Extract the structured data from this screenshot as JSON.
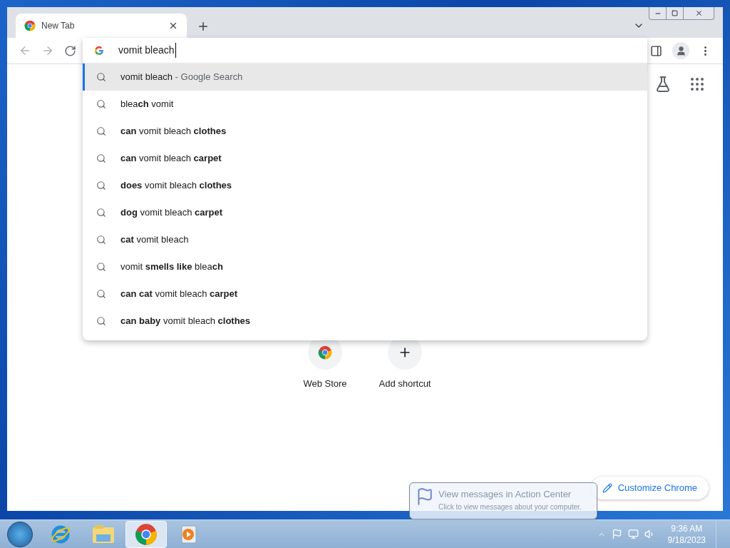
{
  "tab": {
    "title": "New Tab",
    "selected": true
  },
  "omnibox": {
    "value": "vomit bleach"
  },
  "suggestions": [
    {
      "text": "vomit bleach",
      "suffix": "- Google Search",
      "selected": true
    },
    {
      "text": "blea**ch** vomit",
      "selected": false
    },
    {
      "text": "**can** vomit bleach **clothes**",
      "selected": false
    },
    {
      "text": "**can** vomit bleach **carpet**",
      "selected": false
    },
    {
      "text": "**does** vomit bleach **clothes**",
      "selected": false
    },
    {
      "text": "**dog** vomit bleach **carpet**",
      "selected": false
    },
    {
      "text": "**cat** vomit bleach",
      "selected": false
    },
    {
      "text": "vomit **smells like** blea**ch**",
      "selected": false
    },
    {
      "text": "**can cat** vomit bleach **carpet**",
      "selected": false
    },
    {
      "text": "**can baby** vomit bleach **clothes**",
      "selected": false
    }
  ],
  "shortcuts": [
    {
      "label": "Web Store",
      "kind": "webstore"
    },
    {
      "label": "Add shortcut",
      "kind": "add"
    }
  ],
  "customize_button": "Customize Chrome",
  "notification": {
    "title": "View messages in Action Center",
    "message": "Click to view messages about your computer."
  },
  "taskbar": {
    "apps": [
      {
        "kind": "ie",
        "selected": false
      },
      {
        "kind": "explorer",
        "selected": false
      },
      {
        "kind": "chrome",
        "selected": true
      },
      {
        "kind": "media",
        "selected": false
      }
    ]
  },
  "clock": {
    "time": "9:36 AM",
    "date": "9/18/2023"
  }
}
